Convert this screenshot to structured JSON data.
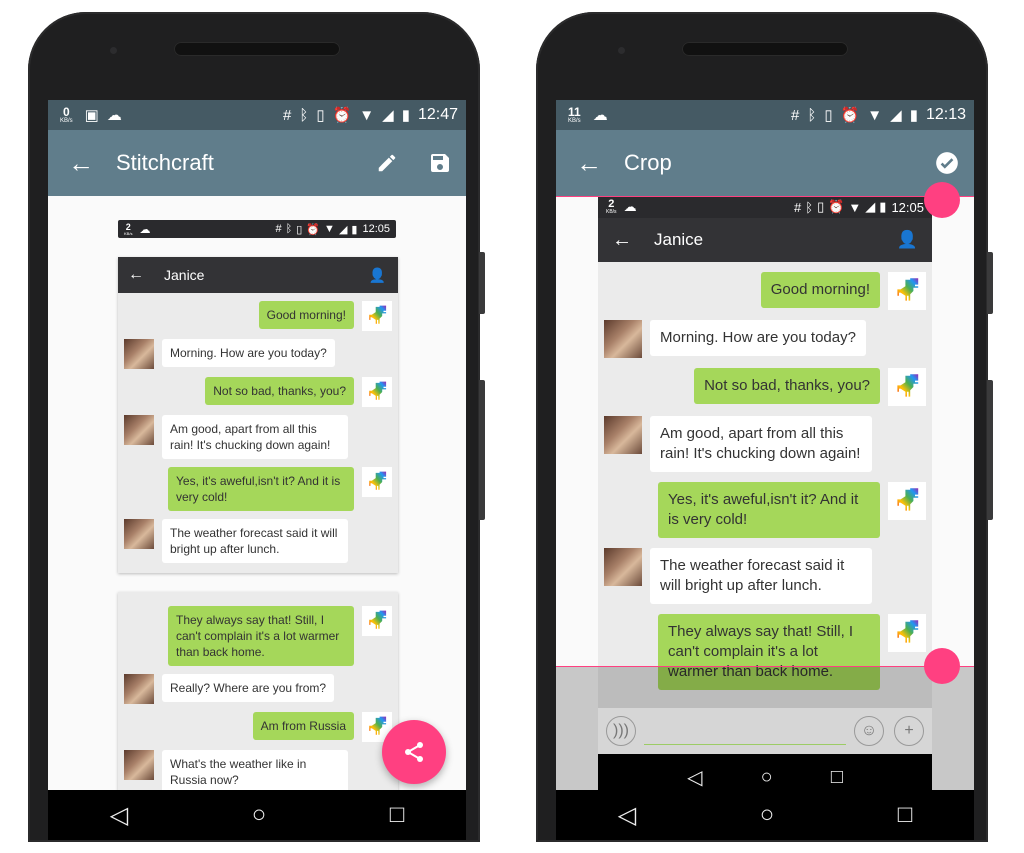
{
  "left_phone": {
    "status_bar": {
      "kb_value": "0",
      "kb_unit": "KB/s",
      "left_icons": [
        "android-icon",
        "cloud-icon"
      ],
      "right_icons": [
        "hash-icon",
        "bluetooth-icon",
        "vibrate-icon",
        "alarm-icon",
        "wifi-icon",
        "signal-icon",
        "battery-charging-icon"
      ],
      "time": "12:47"
    },
    "app_bar": {
      "back_icon": "arrow-left-icon",
      "title": "Stitchcraft",
      "actions": [
        "pencil-icon",
        "save-icon"
      ]
    },
    "captured_status": {
      "kb_value": "2",
      "kb_unit": "KB/s",
      "time": "12:05"
    },
    "chat": {
      "contact_name": "Janice",
      "card1_messages": [
        {
          "dir": "out",
          "text": "Good morning!"
        },
        {
          "dir": "in",
          "text": "Morning. How are you today?"
        },
        {
          "dir": "out",
          "text": "Not so bad, thanks, you?"
        },
        {
          "dir": "in",
          "text": "Am good, apart from all this rain! It's chucking down again!"
        },
        {
          "dir": "out",
          "text": "Yes, it's aweful,isn't it? And it is very cold!"
        },
        {
          "dir": "in",
          "text": "The weather forecast said it will bright up after lunch."
        }
      ],
      "card2_messages": [
        {
          "dir": "out",
          "text": "They always say that! Still, I can't complain it's a lot warmer than back home."
        },
        {
          "dir": "in",
          "text": "Really? Where are you from?"
        },
        {
          "dir": "out",
          "text": "Am from Russia"
        },
        {
          "dir": "in",
          "text": "What's the weather like in Russia now?"
        }
      ]
    },
    "fab": {
      "icon": "share-icon",
      "color": "#ff4081"
    },
    "nav": [
      "back-triangle-icon",
      "home-circle-icon",
      "recents-square-icon"
    ]
  },
  "right_phone": {
    "status_bar": {
      "kb_value": "11",
      "kb_unit": "KB/s",
      "left_icons": [
        "cloud-icon"
      ],
      "right_icons": [
        "hash-icon",
        "bluetooth-icon",
        "vibrate-icon",
        "alarm-icon",
        "wifi-icon",
        "signal-icon",
        "battery-full-icon"
      ],
      "time": "12:13"
    },
    "app_bar": {
      "back_icon": "arrow-left-icon",
      "title": "Crop",
      "actions": [
        "check-circle-icon"
      ]
    },
    "captured_status": {
      "kb_value": "2",
      "kb_unit": "KB/s",
      "time": "12:05"
    },
    "chat": {
      "contact_name": "Janice",
      "messages": [
        {
          "dir": "out",
          "text": "Good morning!"
        },
        {
          "dir": "in",
          "text": "Morning. How are you today?"
        },
        {
          "dir": "out",
          "text": "Not so bad, thanks, you?"
        },
        {
          "dir": "in",
          "text": "Am good, apart from all this rain! It's chucking down again!"
        },
        {
          "dir": "out",
          "text": "Yes, it's aweful,isn't it? And it is very cold!"
        },
        {
          "dir": "in",
          "text": "The weather forecast said it will bright up after lunch."
        },
        {
          "dir": "out",
          "text": "They always say that! Still, I can't complain it's a lot warmer than back home."
        }
      ],
      "composer": {
        "voice_icon": "voice-icon",
        "emoji_icon": "emoji-icon",
        "add_icon": "plus-icon",
        "placeholder": ""
      }
    },
    "crop": {
      "accent": "#ff4081"
    },
    "nav": [
      "back-triangle-icon",
      "home-circle-icon",
      "recents-square-icon"
    ]
  },
  "colors": {
    "status_bar": "#455a64",
    "app_bar": "#607d8b",
    "bubble_out": "#a5d75a",
    "bubble_in": "#ffffff",
    "chat_bg": "#ebebeb",
    "chat_header": "#333336"
  }
}
